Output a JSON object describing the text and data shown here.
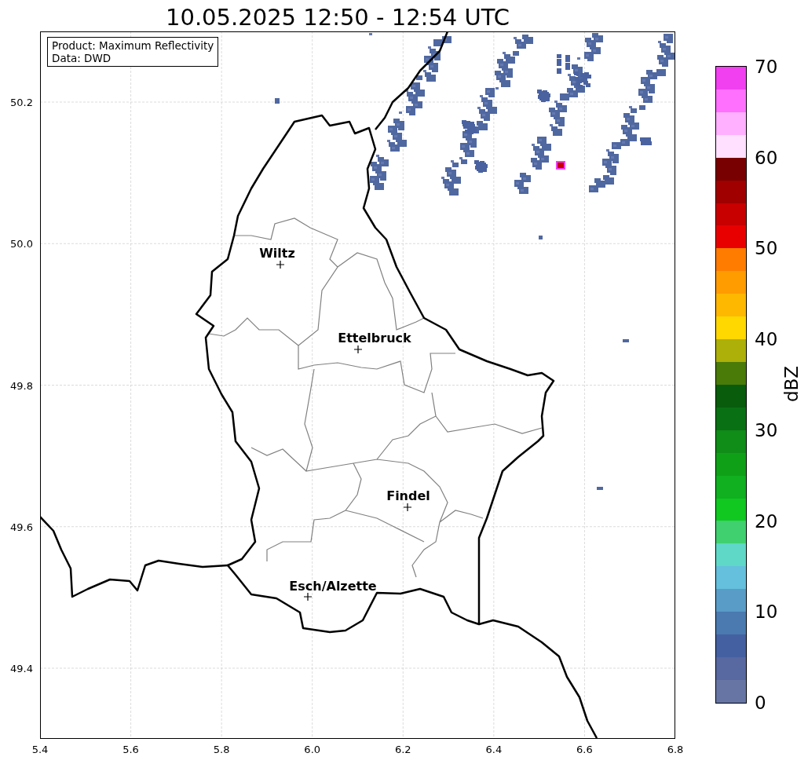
{
  "title": "10.05.2025 12:50 - 12:54 UTC",
  "info_box": [
    "Product: Maximum Reflectivity",
    "Data: DWD"
  ],
  "x_ticks": [
    "5.4",
    "5.6",
    "5.8",
    "6.0",
    "6.2",
    "6.4",
    "6.6",
    "6.8"
  ],
  "y_ticks": [
    "50.2",
    "50.0",
    "49.8",
    "49.6",
    "49.4"
  ],
  "cities": [
    {
      "name": "Wiltz"
    },
    {
      "name": "Ettelbruck"
    },
    {
      "name": "Findel"
    },
    {
      "name": "Esch/Alzette"
    }
  ],
  "colorbar": {
    "label": "dBZ",
    "ticks": [
      "70",
      "60",
      "50",
      "40",
      "30",
      "20",
      "10",
      "0"
    ],
    "segments": [
      {
        "color": "#f040f0"
      },
      {
        "color": "#ff70ff"
      },
      {
        "color": "#ffb0ff"
      },
      {
        "color": "#ffe0ff"
      },
      {
        "color": "#780000"
      },
      {
        "color": "#a00000"
      },
      {
        "color": "#c80000"
      },
      {
        "color": "#e80000"
      },
      {
        "color": "#ff7c00"
      },
      {
        "color": "#ff9c00"
      },
      {
        "color": "#ffb800"
      },
      {
        "color": "#ffd800"
      },
      {
        "color": "#acb008"
      },
      {
        "color": "#4a7a08"
      },
      {
        "color": "#085c0c"
      },
      {
        "color": "#0a7014"
      },
      {
        "color": "#108c18"
      },
      {
        "color": "#10a018"
      },
      {
        "color": "#10b020"
      },
      {
        "color": "#10c820"
      },
      {
        "color": "#40d070"
      },
      {
        "color": "#60d8c8"
      },
      {
        "color": "#64c0dc"
      },
      {
        "color": "#5a9cc8"
      },
      {
        "color": "#4a7ab0"
      },
      {
        "color": "#4560a0"
      },
      {
        "color": "#5868a0"
      },
      {
        "color": "#6675a4"
      }
    ]
  }
}
